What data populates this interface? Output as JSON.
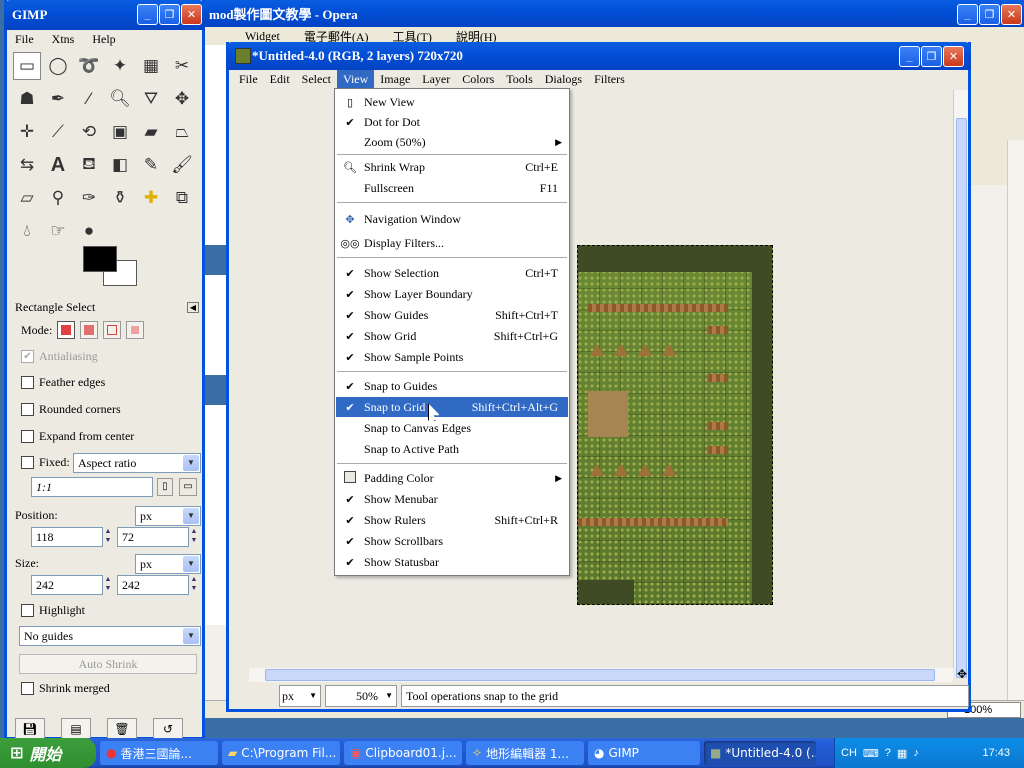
{
  "opera": {
    "title": "mod製作圖文教學 - Opera",
    "menu": [
      "Widget",
      "電子郵件(A)",
      "工具(T)",
      "說明(H)"
    ],
    "zoom": "100%"
  },
  "toolbox": {
    "title": "GIMP",
    "menu": [
      "File",
      "Xtns",
      "Help"
    ],
    "tool_options_title": "Rectangle Select",
    "mode_label": "Mode:",
    "antialiasing": "Antialiasing",
    "feather_edges": "Feather edges",
    "rounded_corners": "Rounded corners",
    "expand_from_center": "Expand from center",
    "fixed": "Fixed:",
    "fixed_mode": "Aspect ratio",
    "ratio_value": "1:1",
    "position_label": "Position:",
    "position_unit": "px",
    "position_x": "118",
    "position_y": "72",
    "size_label": "Size:",
    "size_unit": "px",
    "size_w": "242",
    "size_h": "242",
    "highlight": "Highlight",
    "guides": "No guides",
    "auto_shrink": "Auto Shrink",
    "shrink_merged": "Shrink merged"
  },
  "image_window": {
    "title": "*Untitled-4.0 (RGB, 2 layers) 720x720",
    "menu": [
      "File",
      "Edit",
      "Select",
      "View",
      "Image",
      "Layer",
      "Colors",
      "Tools",
      "Dialogs",
      "Filters"
    ],
    "status_unit": "px",
    "status_zoom": "50%",
    "status_message": "Tool operations snap to the grid"
  },
  "view_menu": {
    "items": [
      {
        "label": "New View",
        "check": "",
        "shortcut": "",
        "submenu": false
      },
      {
        "label": "Dot for Dot",
        "check": "✔",
        "shortcut": "",
        "submenu": false
      },
      {
        "label": "Zoom (50%)",
        "check": "",
        "shortcut": "",
        "submenu": true
      },
      {
        "label": "Shrink Wrap",
        "check": "",
        "shortcut": "Ctrl+E",
        "submenu": false
      },
      {
        "label": "Fullscreen",
        "check": "",
        "shortcut": "F11",
        "submenu": false
      },
      {
        "label": "Navigation Window",
        "check": "",
        "shortcut": "",
        "submenu": false
      },
      {
        "label": "Display Filters...",
        "check": "",
        "shortcut": "",
        "submenu": false
      },
      {
        "label": "Show Selection",
        "check": "✔",
        "shortcut": "Ctrl+T",
        "submenu": false
      },
      {
        "label": "Show Layer Boundary",
        "check": "✔",
        "shortcut": "",
        "submenu": false
      },
      {
        "label": "Show Guides",
        "check": "✔",
        "shortcut": "Shift+Ctrl+T",
        "submenu": false
      },
      {
        "label": "Show Grid",
        "check": "✔",
        "shortcut": "Shift+Ctrl+G",
        "submenu": false
      },
      {
        "label": "Show Sample Points",
        "check": "✔",
        "shortcut": "",
        "submenu": false
      },
      {
        "label": "Snap to Guides",
        "check": "✔",
        "shortcut": "",
        "submenu": false
      },
      {
        "label": "Snap to Grid",
        "check": "✔",
        "shortcut": "Shift+Ctrl+Alt+G",
        "submenu": false
      },
      {
        "label": "Snap to Canvas Edges",
        "check": "",
        "shortcut": "",
        "submenu": false
      },
      {
        "label": "Snap to Active Path",
        "check": "",
        "shortcut": "",
        "submenu": false
      },
      {
        "label": "Padding Color",
        "check": "",
        "shortcut": "",
        "submenu": true
      },
      {
        "label": "Show Menubar",
        "check": "✔",
        "shortcut": "",
        "submenu": false
      },
      {
        "label": "Show Rulers",
        "check": "✔",
        "shortcut": "Shift+Ctrl+R",
        "submenu": false
      },
      {
        "label": "Show Scrollbars",
        "check": "✔",
        "shortcut": "",
        "submenu": false
      },
      {
        "label": "Show Statusbar",
        "check": "✔",
        "shortcut": "",
        "submenu": false
      }
    ]
  },
  "taskbar": {
    "start": "開始",
    "tasks": [
      "香港三國論...",
      "C:\\Program Fil...",
      "Clipboard01.j...",
      "地形編輯器 1...",
      "GIMP",
      "*Untitled-4.0 (..."
    ],
    "lang": "CH",
    "clock": "17:43"
  },
  "colors": {
    "xp_blue": "#0053e1",
    "menu_highlight": "#316ac5",
    "start_green": "#3c9e3c"
  }
}
